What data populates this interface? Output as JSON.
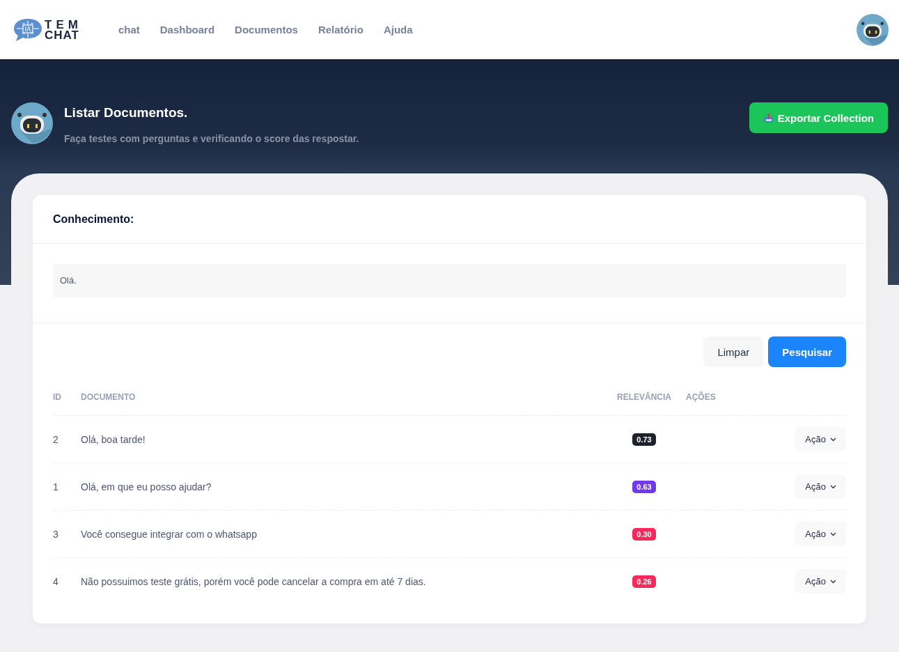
{
  "logo": {
    "top": "TEM",
    "bottom": "CHAT",
    "mark": "IA"
  },
  "nav": [
    {
      "label": "chat"
    },
    {
      "label": "Dashboard"
    },
    {
      "label": "Documentos"
    },
    {
      "label": "Relatório"
    },
    {
      "label": "Ajuda"
    }
  ],
  "hero": {
    "title": "Listar Documentos.",
    "subtitle": "Faça testes com perguntas e verificando o score das respostar.",
    "export_button": "Exportar Collection"
  },
  "card": {
    "title": "Conhecimento:",
    "query": "Olá.",
    "buttons": {
      "clear": "Limpar",
      "search": "Pesquisar"
    }
  },
  "table": {
    "columns": [
      "ID",
      "DOCUMENTO",
      "RELEVÂNCIA",
      "AÇÕES"
    ],
    "rows": [
      {
        "id": "2",
        "document": "Olá, boa tarde!",
        "relevance": "0.73",
        "color": "#1e2129",
        "action": "Ação"
      },
      {
        "id": "1",
        "document": "Olá, em que eu posso ajudar?",
        "relevance": "0.63",
        "color": "#7239ea",
        "action": "Ação"
      },
      {
        "id": "3",
        "document": "Você consegue integrar com o whatsapp",
        "relevance": "0.30",
        "color": "#f8285a",
        "action": "Ação"
      },
      {
        "id": "4",
        "document": "Não possuimos teste grátis, porém você pode cancelar a compra em até 7 dias.",
        "relevance": "0.26",
        "color": "#f8285a",
        "action": "Ação"
      }
    ]
  }
}
